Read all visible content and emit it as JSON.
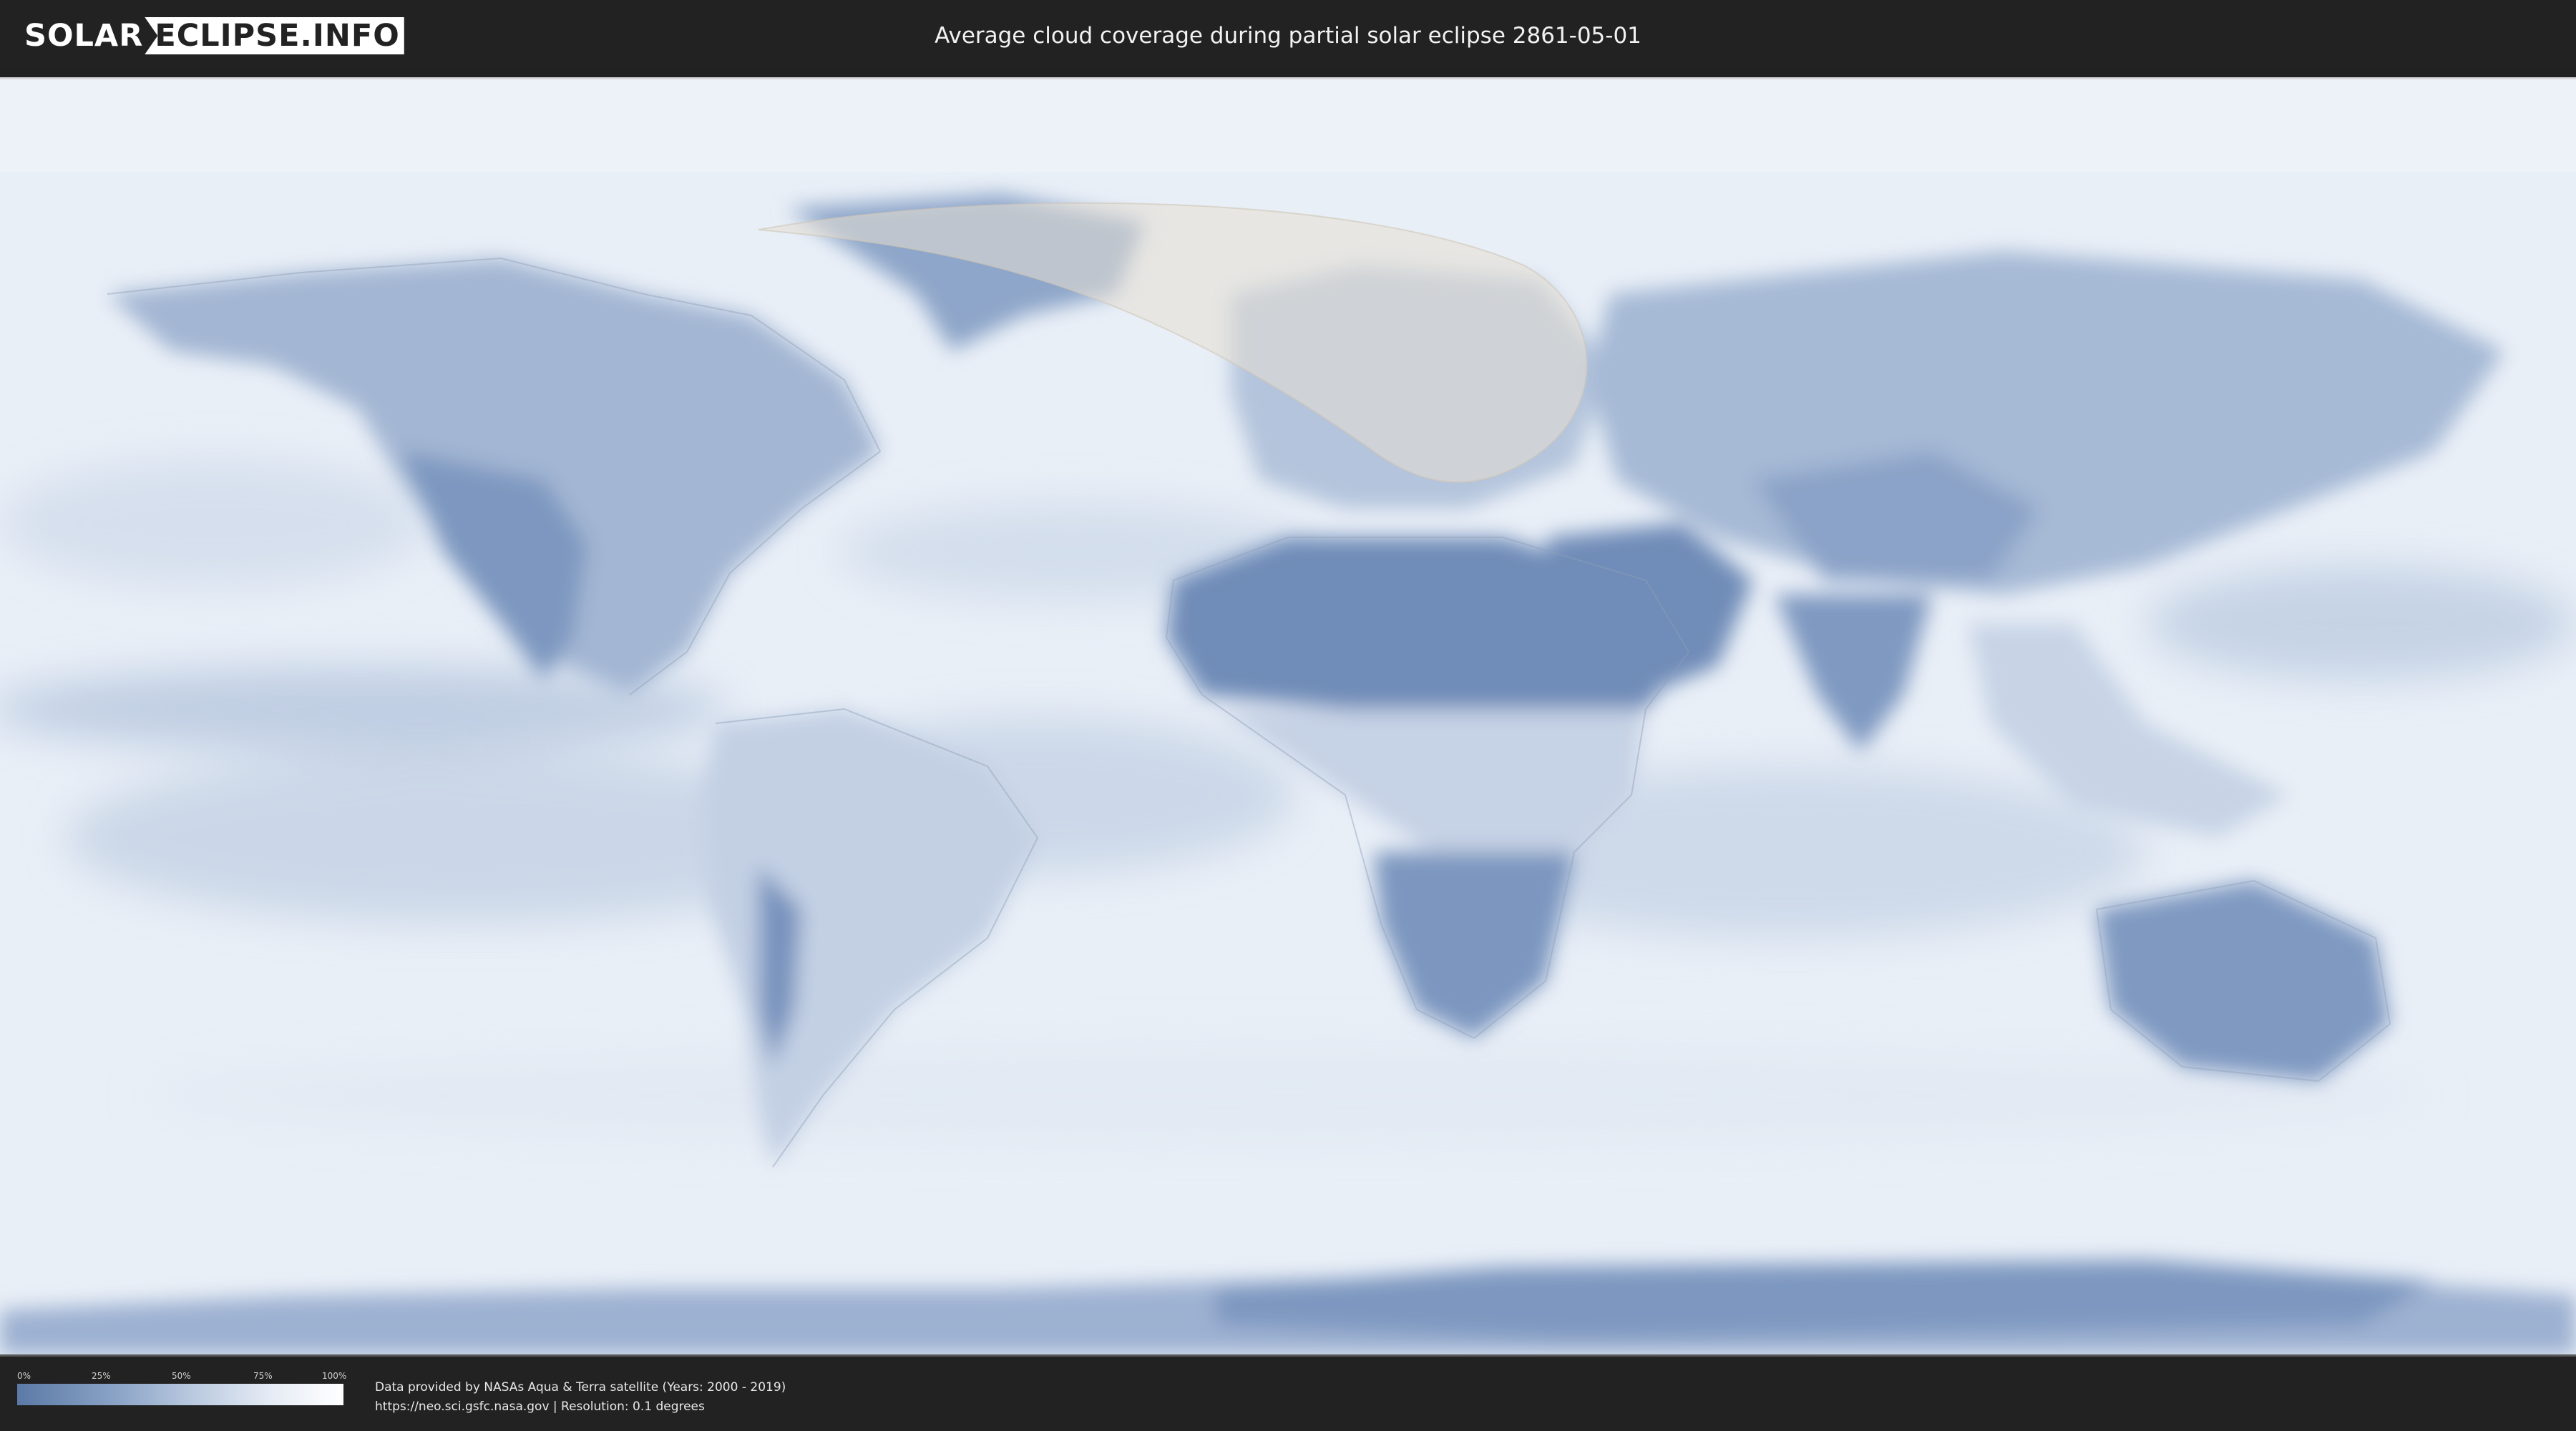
{
  "header": {
    "logo_left": "SOLAR",
    "logo_right": "ECLIPSE.INFO",
    "title": "Average cloud coverage during partial solar eclipse 2861-05-01"
  },
  "legend": {
    "ticks": [
      "0%",
      "25%",
      "50%",
      "75%",
      "100%"
    ],
    "low_color": "#5b7aa6",
    "high_color": "#ffffff"
  },
  "credits": {
    "line1": "Data provided by NASAs Aqua & Terra satellite (Years: 2000 - 2019)",
    "line2": "https://neo.sci.gsfc.nasa.gov | Resolution: 0.1 degrees"
  },
  "map": {
    "projection": "equirectangular",
    "ocean_color": "#e9eff7",
    "clear_sky_color": "#6f8db8",
    "eclipse_zone_color": "#e6dfd2"
  }
}
